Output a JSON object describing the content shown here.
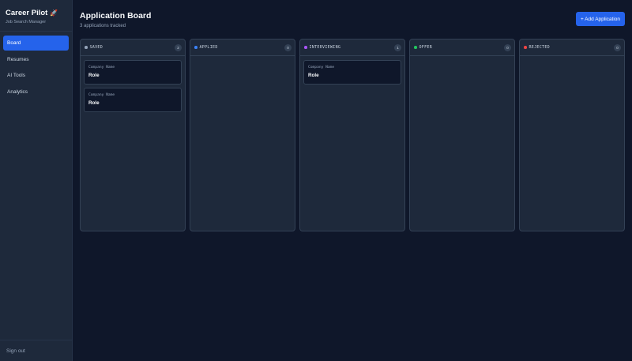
{
  "sidebar": {
    "brand_title": "Career Pilot",
    "brand_icon": "🚀",
    "brand_subtitle": "Job Search Manager",
    "items": [
      {
        "label": "Board",
        "active": true
      },
      {
        "label": "Resumes",
        "active": false
      },
      {
        "label": "AI Tools",
        "active": false
      },
      {
        "label": "Analytics",
        "active": false
      }
    ],
    "signout_label": "Sign out"
  },
  "header": {
    "title": "Application Board",
    "subtitle": "3 applications tracked",
    "add_button_label": "+ Add Application"
  },
  "columns": [
    {
      "title": "SAVED",
      "count": "2",
      "color": "#94a3b8",
      "cards": [
        {
          "company": "Company Name",
          "role": "Role"
        },
        {
          "company": "Company Name",
          "role": "Role"
        }
      ]
    },
    {
      "title": "APPLIED",
      "count": "0",
      "color": "#3b82f6",
      "cards": []
    },
    {
      "title": "INTERVIEWING",
      "count": "1",
      "color": "#a855f7",
      "cards": [
        {
          "company": "Company Name",
          "role": "Role"
        }
      ]
    },
    {
      "title": "OFFER",
      "count": "0",
      "color": "#22c55e",
      "cards": []
    },
    {
      "title": "REJECTED",
      "count": "0",
      "color": "#ef4444",
      "cards": []
    }
  ],
  "colors": {
    "accent": "#2563eb",
    "background": "#0f172a",
    "panel": "#1e293b"
  }
}
